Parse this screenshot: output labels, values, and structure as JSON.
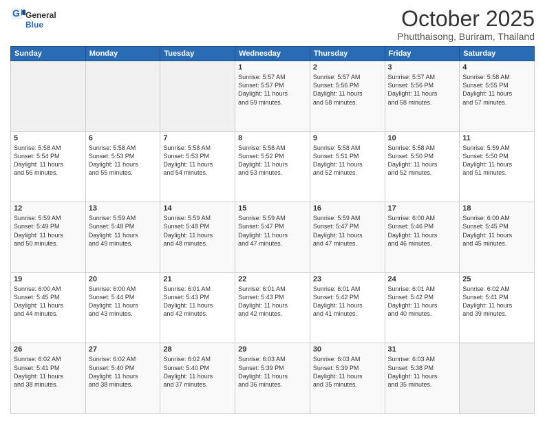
{
  "logo": {
    "general": "General",
    "blue": "Blue"
  },
  "title": "October 2025",
  "location": "Phutthaisong, Buriram, Thailand",
  "days_header": [
    "Sunday",
    "Monday",
    "Tuesday",
    "Wednesday",
    "Thursday",
    "Friday",
    "Saturday"
  ],
  "weeks": [
    [
      {
        "num": "",
        "info": ""
      },
      {
        "num": "",
        "info": ""
      },
      {
        "num": "",
        "info": ""
      },
      {
        "num": "1",
        "info": "Sunrise: 5:57 AM\nSunset: 5:57 PM\nDaylight: 11 hours\nand 59 minutes."
      },
      {
        "num": "2",
        "info": "Sunrise: 5:57 AM\nSunset: 5:56 PM\nDaylight: 11 hours\nand 58 minutes."
      },
      {
        "num": "3",
        "info": "Sunrise: 5:57 AM\nSunset: 5:56 PM\nDaylight: 11 hours\nand 58 minutes."
      },
      {
        "num": "4",
        "info": "Sunrise: 5:58 AM\nSunset: 5:55 PM\nDaylight: 11 hours\nand 57 minutes."
      }
    ],
    [
      {
        "num": "5",
        "info": "Sunrise: 5:58 AM\nSunset: 5:54 PM\nDaylight: 11 hours\nand 56 minutes."
      },
      {
        "num": "6",
        "info": "Sunrise: 5:58 AM\nSunset: 5:53 PM\nDaylight: 11 hours\nand 55 minutes."
      },
      {
        "num": "7",
        "info": "Sunrise: 5:58 AM\nSunset: 5:53 PM\nDaylight: 11 hours\nand 54 minutes."
      },
      {
        "num": "8",
        "info": "Sunrise: 5:58 AM\nSunset: 5:52 PM\nDaylight: 11 hours\nand 53 minutes."
      },
      {
        "num": "9",
        "info": "Sunrise: 5:58 AM\nSunset: 5:51 PM\nDaylight: 11 hours\nand 52 minutes."
      },
      {
        "num": "10",
        "info": "Sunrise: 5:58 AM\nSunset: 5:50 PM\nDaylight: 11 hours\nand 52 minutes."
      },
      {
        "num": "11",
        "info": "Sunrise: 5:59 AM\nSunset: 5:50 PM\nDaylight: 11 hours\nand 51 minutes."
      }
    ],
    [
      {
        "num": "12",
        "info": "Sunrise: 5:59 AM\nSunset: 5:49 PM\nDaylight: 11 hours\nand 50 minutes."
      },
      {
        "num": "13",
        "info": "Sunrise: 5:59 AM\nSunset: 5:48 PM\nDaylight: 11 hours\nand 49 minutes."
      },
      {
        "num": "14",
        "info": "Sunrise: 5:59 AM\nSunset: 5:48 PM\nDaylight: 11 hours\nand 48 minutes."
      },
      {
        "num": "15",
        "info": "Sunrise: 5:59 AM\nSunset: 5:47 PM\nDaylight: 11 hours\nand 47 minutes."
      },
      {
        "num": "16",
        "info": "Sunrise: 5:59 AM\nSunset: 5:47 PM\nDaylight: 11 hours\nand 47 minutes."
      },
      {
        "num": "17",
        "info": "Sunrise: 6:00 AM\nSunset: 5:46 PM\nDaylight: 11 hours\nand 46 minutes."
      },
      {
        "num": "18",
        "info": "Sunrise: 6:00 AM\nSunset: 5:45 PM\nDaylight: 11 hours\nand 45 minutes."
      }
    ],
    [
      {
        "num": "19",
        "info": "Sunrise: 6:00 AM\nSunset: 5:45 PM\nDaylight: 11 hours\nand 44 minutes."
      },
      {
        "num": "20",
        "info": "Sunrise: 6:00 AM\nSunset: 5:44 PM\nDaylight: 11 hours\nand 43 minutes."
      },
      {
        "num": "21",
        "info": "Sunrise: 6:01 AM\nSunset: 5:43 PM\nDaylight: 11 hours\nand 42 minutes."
      },
      {
        "num": "22",
        "info": "Sunrise: 6:01 AM\nSunset: 5:43 PM\nDaylight: 11 hours\nand 42 minutes."
      },
      {
        "num": "23",
        "info": "Sunrise: 6:01 AM\nSunset: 5:42 PM\nDaylight: 11 hours\nand 41 minutes."
      },
      {
        "num": "24",
        "info": "Sunrise: 6:01 AM\nSunset: 5:42 PM\nDaylight: 11 hours\nand 40 minutes."
      },
      {
        "num": "25",
        "info": "Sunrise: 6:02 AM\nSunset: 5:41 PM\nDaylight: 11 hours\nand 39 minutes."
      }
    ],
    [
      {
        "num": "26",
        "info": "Sunrise: 6:02 AM\nSunset: 5:41 PM\nDaylight: 11 hours\nand 38 minutes."
      },
      {
        "num": "27",
        "info": "Sunrise: 6:02 AM\nSunset: 5:40 PM\nDaylight: 11 hours\nand 38 minutes."
      },
      {
        "num": "28",
        "info": "Sunrise: 6:02 AM\nSunset: 5:40 PM\nDaylight: 11 hours\nand 37 minutes."
      },
      {
        "num": "29",
        "info": "Sunrise: 6:03 AM\nSunset: 5:39 PM\nDaylight: 11 hours\nand 36 minutes."
      },
      {
        "num": "30",
        "info": "Sunrise: 6:03 AM\nSunset: 5:39 PM\nDaylight: 11 hours\nand 35 minutes."
      },
      {
        "num": "31",
        "info": "Sunrise: 6:03 AM\nSunset: 5:38 PM\nDaylight: 11 hours\nand 35 minutes."
      },
      {
        "num": "",
        "info": ""
      }
    ]
  ]
}
